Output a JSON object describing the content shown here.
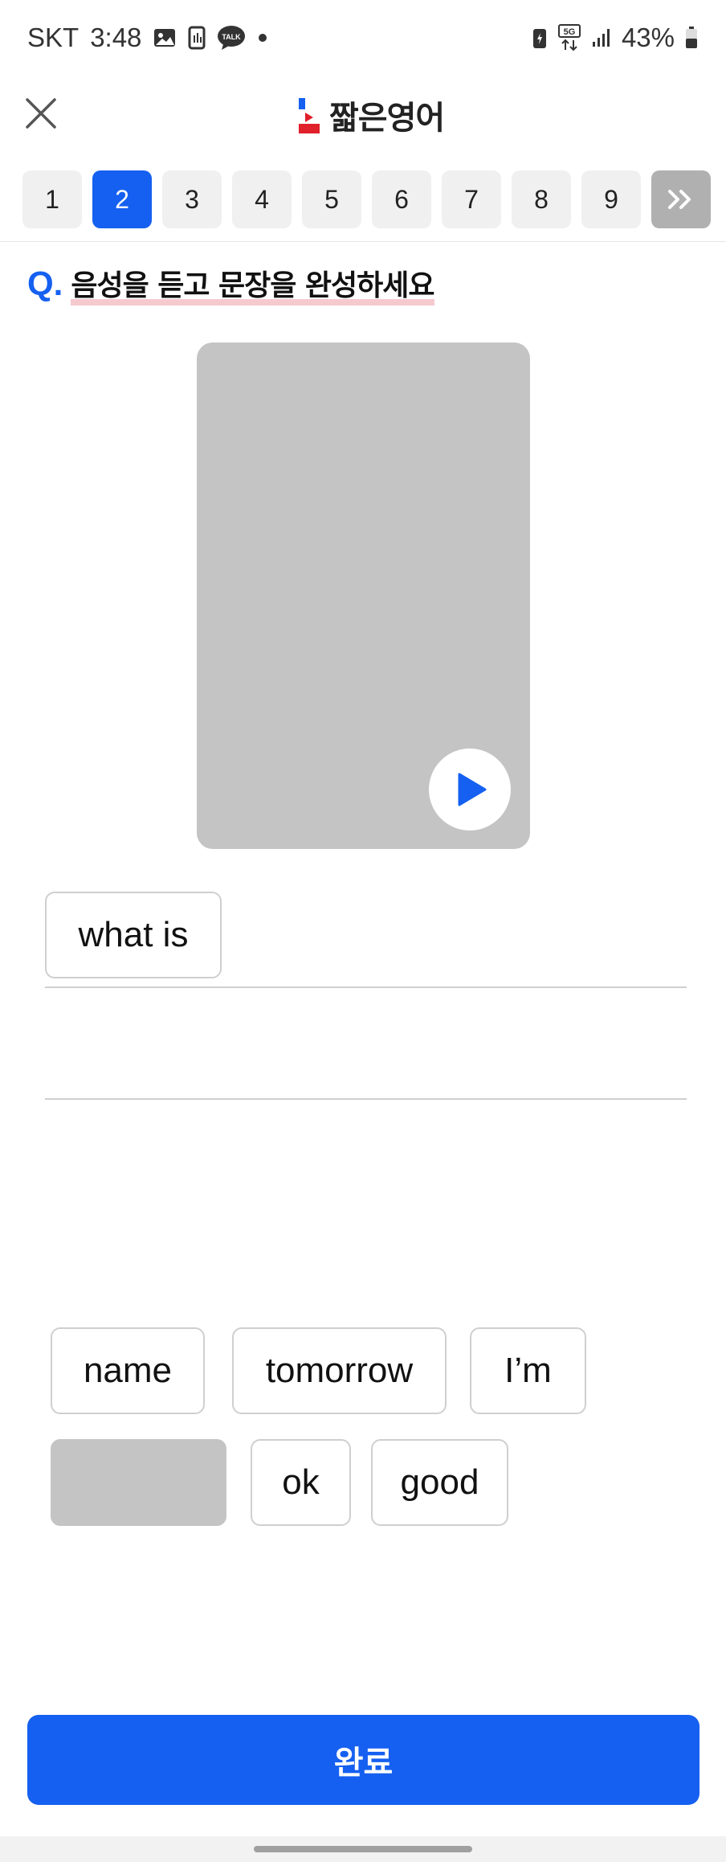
{
  "status_bar": {
    "carrier": "SKT",
    "time": "3:48",
    "network": "5G",
    "battery": "43%",
    "notification_icons": [
      "image-icon",
      "phone-data-icon",
      "talk-icon",
      "dot-icon"
    ]
  },
  "header": {
    "logo_text": "짧은영어",
    "colors": {
      "logo_blue": "#1560f0",
      "logo_red": "#e0202a"
    }
  },
  "tabs": {
    "items": [
      "1",
      "2",
      "3",
      "4",
      "5",
      "6",
      "7",
      "8",
      "9"
    ],
    "active": "2",
    "next_label": "»"
  },
  "question": {
    "mark": "Q.",
    "text": "음성을 듣고 문장을 완성하세요"
  },
  "answer": {
    "selected_chips": [
      "what is"
    ]
  },
  "word_bank": {
    "words": [
      "name",
      "tomorrow",
      "I’m",
      "",
      "ok",
      "good"
    ]
  },
  "footer": {
    "complete_label": "완료"
  },
  "colors": {
    "accent": "#1560f0",
    "placeholder_gray": "#c4c4c4",
    "tab_bg": "#f0f0f0"
  }
}
